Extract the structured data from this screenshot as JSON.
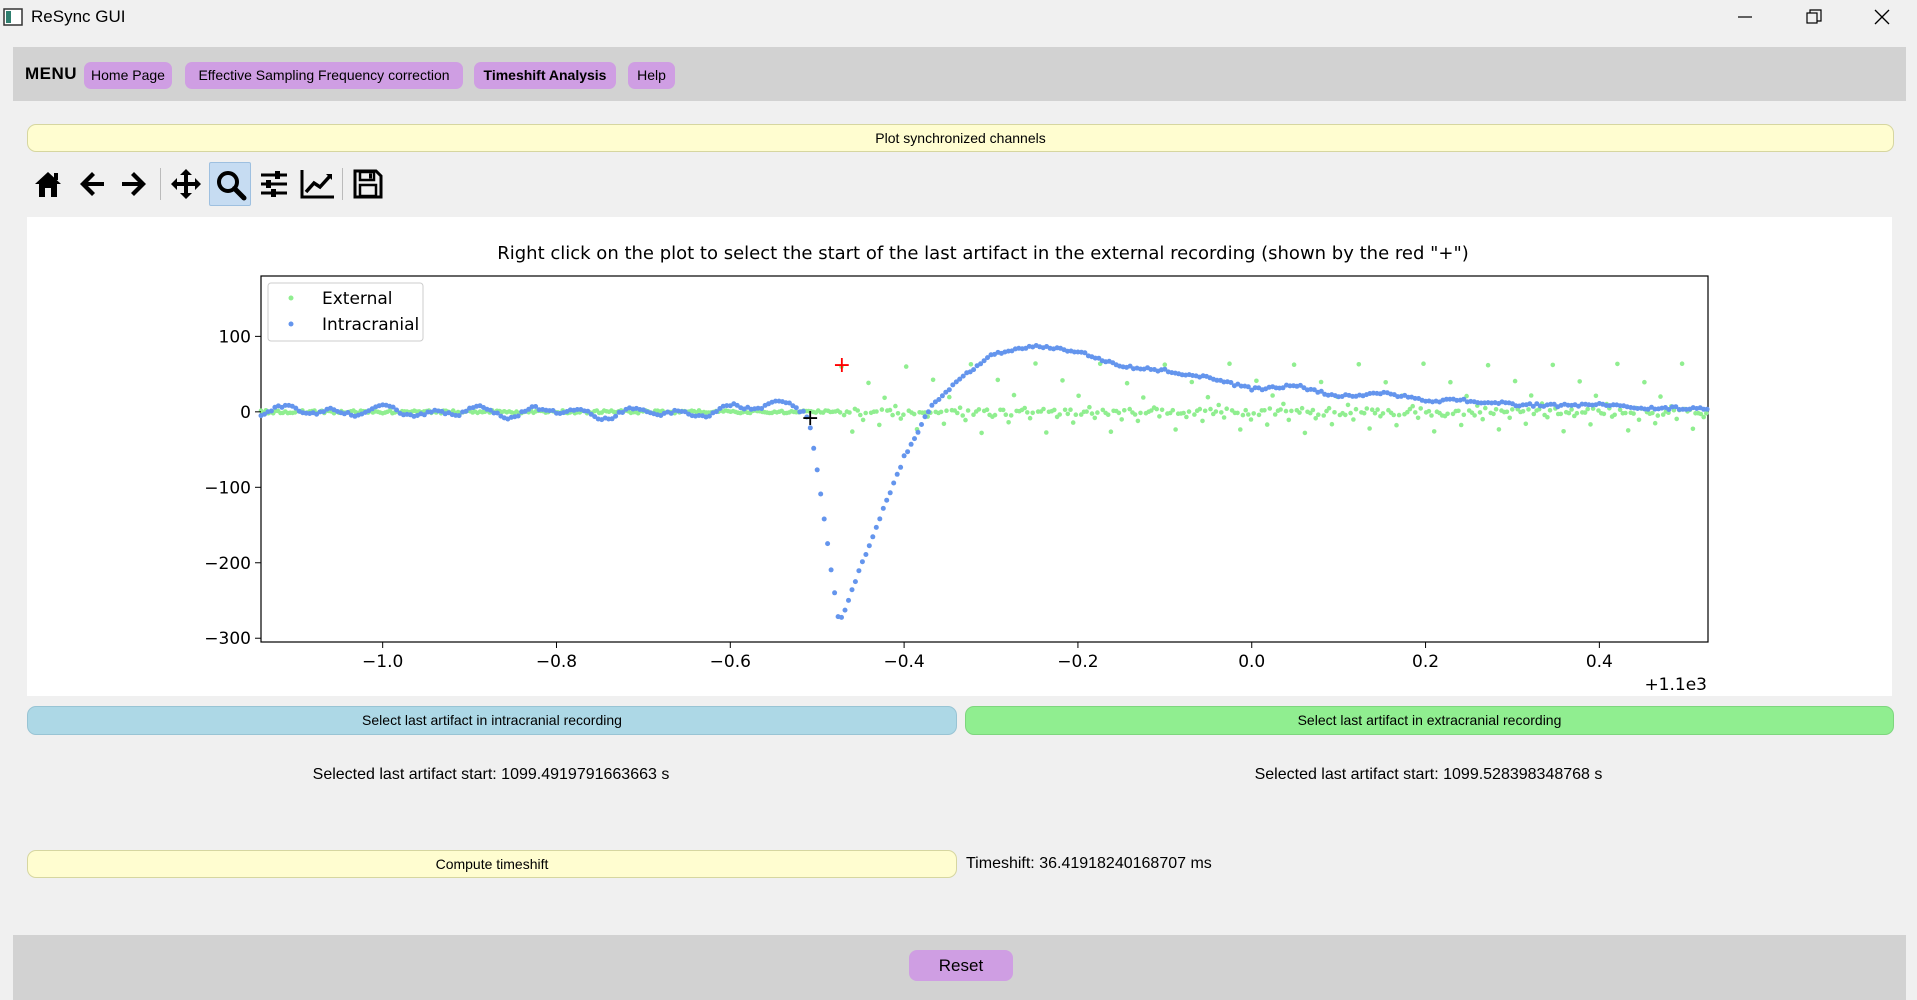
{
  "window": {
    "title": "ReSync GUI",
    "controls": [
      "minimize-icon",
      "restore-icon",
      "close-icon"
    ]
  },
  "menu": {
    "label": "MENU",
    "items": [
      {
        "label": "Home Page",
        "active": false
      },
      {
        "label": "Effective Sampling Frequency correction",
        "active": false
      },
      {
        "label": "Timeshift Analysis",
        "active": true
      },
      {
        "label": "Help",
        "active": false
      }
    ]
  },
  "plot_sync_button": "Plot synchronized channels",
  "toolbar": {
    "icons": [
      "home-icon",
      "back-icon",
      "forward-icon",
      "pan-icon",
      "zoom-icon",
      "subplots-config-icon",
      "edit-axis-icon",
      "save-icon"
    ],
    "active": "zoom-icon"
  },
  "chart_data": {
    "type": "scatter",
    "title": "Right click on the plot to select the start of the last artifact in the external recording (shown by the red \"+\")",
    "xlabel": "",
    "ylabel": "",
    "x_offset_label": "+1.1e3",
    "xlim": [
      1098.86,
      1100.525
    ],
    "ylim": [
      -305,
      180
    ],
    "xticks": [
      -1.0,
      -0.8,
      -0.6,
      -0.4,
      -0.2,
      0.0,
      0.2,
      0.4
    ],
    "xtick_labels": [
      "−1.0",
      "−0.8",
      "−0.6",
      "−0.4",
      "−0.2",
      "0.0",
      "0.2",
      "0.4"
    ],
    "yticks": [
      100,
      0,
      -100,
      -200,
      -300
    ],
    "ytick_labels": [
      "100",
      "0",
      "−100",
      "−200",
      "−300"
    ],
    "legend": {
      "position": "upper-left",
      "entries": [
        "External",
        "Intracranial"
      ]
    },
    "series": [
      {
        "name": "External",
        "color": "#90ee90",
        "description_points": "flat near 0 until artifact start (~1099.53 s), then pulse train alternating ~+62 / 0 / -25",
        "baseline": {
          "x_start": 1098.86,
          "x_end": 1099.528,
          "y": 0
        },
        "pulses": {
          "x_start": 1099.528,
          "x_end": 1100.525,
          "levels": [
            62,
            40,
            20,
            8,
            0,
            -8,
            -15,
            -25
          ]
        }
      },
      {
        "name": "Intracranial",
        "color": "#6495ed",
        "x": [
          1098.86,
          1098.9,
          1098.95,
          1099.0,
          1099.05,
          1099.1,
          1099.15,
          1099.2,
          1099.25,
          1099.3,
          1099.35,
          1099.4,
          1099.45,
          1099.48,
          1099.49,
          1099.5,
          1099.51,
          1099.525,
          1099.53,
          1099.55,
          1099.6,
          1099.63,
          1099.66,
          1099.7,
          1099.75,
          1099.8,
          1099.85,
          1099.9,
          1099.95,
          1100.0,
          1100.05,
          1100.1,
          1100.15,
          1100.2,
          1100.25,
          1100.3,
          1100.35,
          1100.4,
          1100.45,
          1100.5,
          1100.525
        ],
        "values": [
          0,
          5,
          -3,
          6,
          -5,
          4,
          -4,
          5,
          -6,
          3,
          -5,
          4,
          12,
          5,
          -10,
          -75,
          -160,
          -280,
          -270,
          -205,
          -60,
          5,
          40,
          75,
          88,
          80,
          60,
          55,
          45,
          30,
          35,
          20,
          25,
          15,
          15,
          10,
          8,
          10,
          5,
          5,
          5
        ]
      }
    ],
    "markers": [
      {
        "label": "intracranial selection",
        "symbol": "+",
        "color": "#000000",
        "x": 1099.4919791663663,
        "y": -8
      },
      {
        "label": "external selection",
        "symbol": "+",
        "color": "#ff0000",
        "x": 1099.528398348768,
        "y": 62
      }
    ]
  },
  "select_intra_button": "Select last artifact in intracranial recording",
  "select_extra_button": "Select last artifact in extracranial recording",
  "selected_intra_text": "Selected last artifact start: 1099.4919791663663 s",
  "selected_extra_text": "Selected last artifact start: 1099.528398348768 s",
  "compute_button": "Compute timeshift",
  "timeshift_text": "Timeshift: 36.41918240168707 ms",
  "reset_button": "Reset"
}
